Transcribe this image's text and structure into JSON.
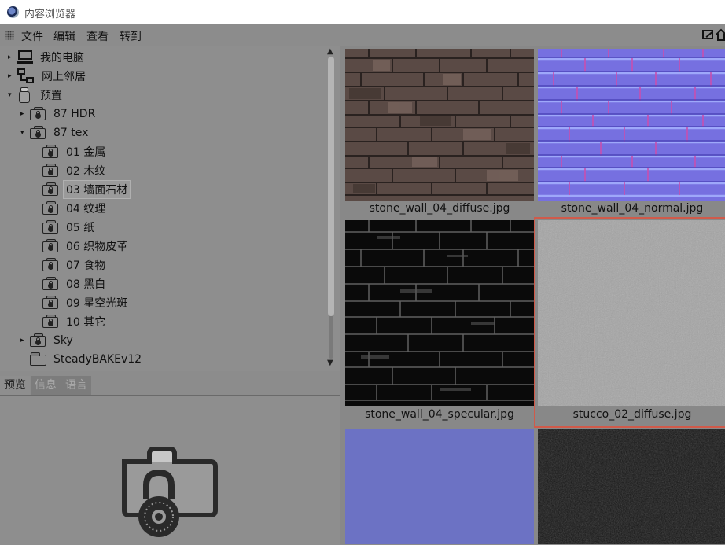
{
  "window": {
    "title": "内容浏览器"
  },
  "menu": {
    "items": [
      "文件",
      "编辑",
      "查看",
      "转到"
    ]
  },
  "tree": {
    "nodes": [
      {
        "label": "我的电脑",
        "arrow": "▸",
        "type": "computer"
      },
      {
        "label": "网上邻居",
        "arrow": "▸",
        "type": "network"
      },
      {
        "label": "预置",
        "arrow": "▾",
        "type": "preset"
      },
      {
        "label": "87 HDR",
        "arrow": "▸",
        "type": "locked-folder"
      },
      {
        "label": "87 tex",
        "arrow": "▾",
        "type": "locked-folder"
      },
      {
        "label": "01 金属",
        "arrow": "",
        "type": "locked-folder"
      },
      {
        "label": "02 木纹",
        "arrow": "",
        "type": "locked-folder"
      },
      {
        "label": "03 墙面石材",
        "arrow": "",
        "type": "locked-folder",
        "selected": true
      },
      {
        "label": "04 纹理",
        "arrow": "",
        "type": "locked-folder"
      },
      {
        "label": "05 纸",
        "arrow": "",
        "type": "locked-folder"
      },
      {
        "label": "06 织物皮革",
        "arrow": "",
        "type": "locked-folder"
      },
      {
        "label": "07 食物",
        "arrow": "",
        "type": "locked-folder"
      },
      {
        "label": "08 黑白",
        "arrow": "",
        "type": "locked-folder"
      },
      {
        "label": "09 星空光斑",
        "arrow": "",
        "type": "locked-folder"
      },
      {
        "label": "10 其它",
        "arrow": "",
        "type": "locked-folder"
      },
      {
        "label": "Sky",
        "arrow": "▸",
        "type": "locked-folder"
      },
      {
        "label": "SteadyBAKEv12",
        "arrow": "",
        "type": "plain-folder"
      }
    ]
  },
  "tabs": [
    "预览",
    "信息",
    "语言"
  ],
  "grid": {
    "items": [
      {
        "filename": "stone_wall_04_diffuse.jpg",
        "kind": "diffuse"
      },
      {
        "filename": "stone_wall_04_normal.jpg",
        "kind": "normal"
      },
      {
        "filename": "stone_wall_04_specular.jpg",
        "kind": "specular"
      },
      {
        "filename": "stucco_02_diffuse.jpg",
        "kind": "stucco",
        "selected": true
      },
      {
        "filename": "",
        "kind": "blue"
      },
      {
        "filename": "",
        "kind": "dark"
      }
    ]
  },
  "colors": {
    "selection": "#d05a4a",
    "panel": "#8e8e8e"
  }
}
